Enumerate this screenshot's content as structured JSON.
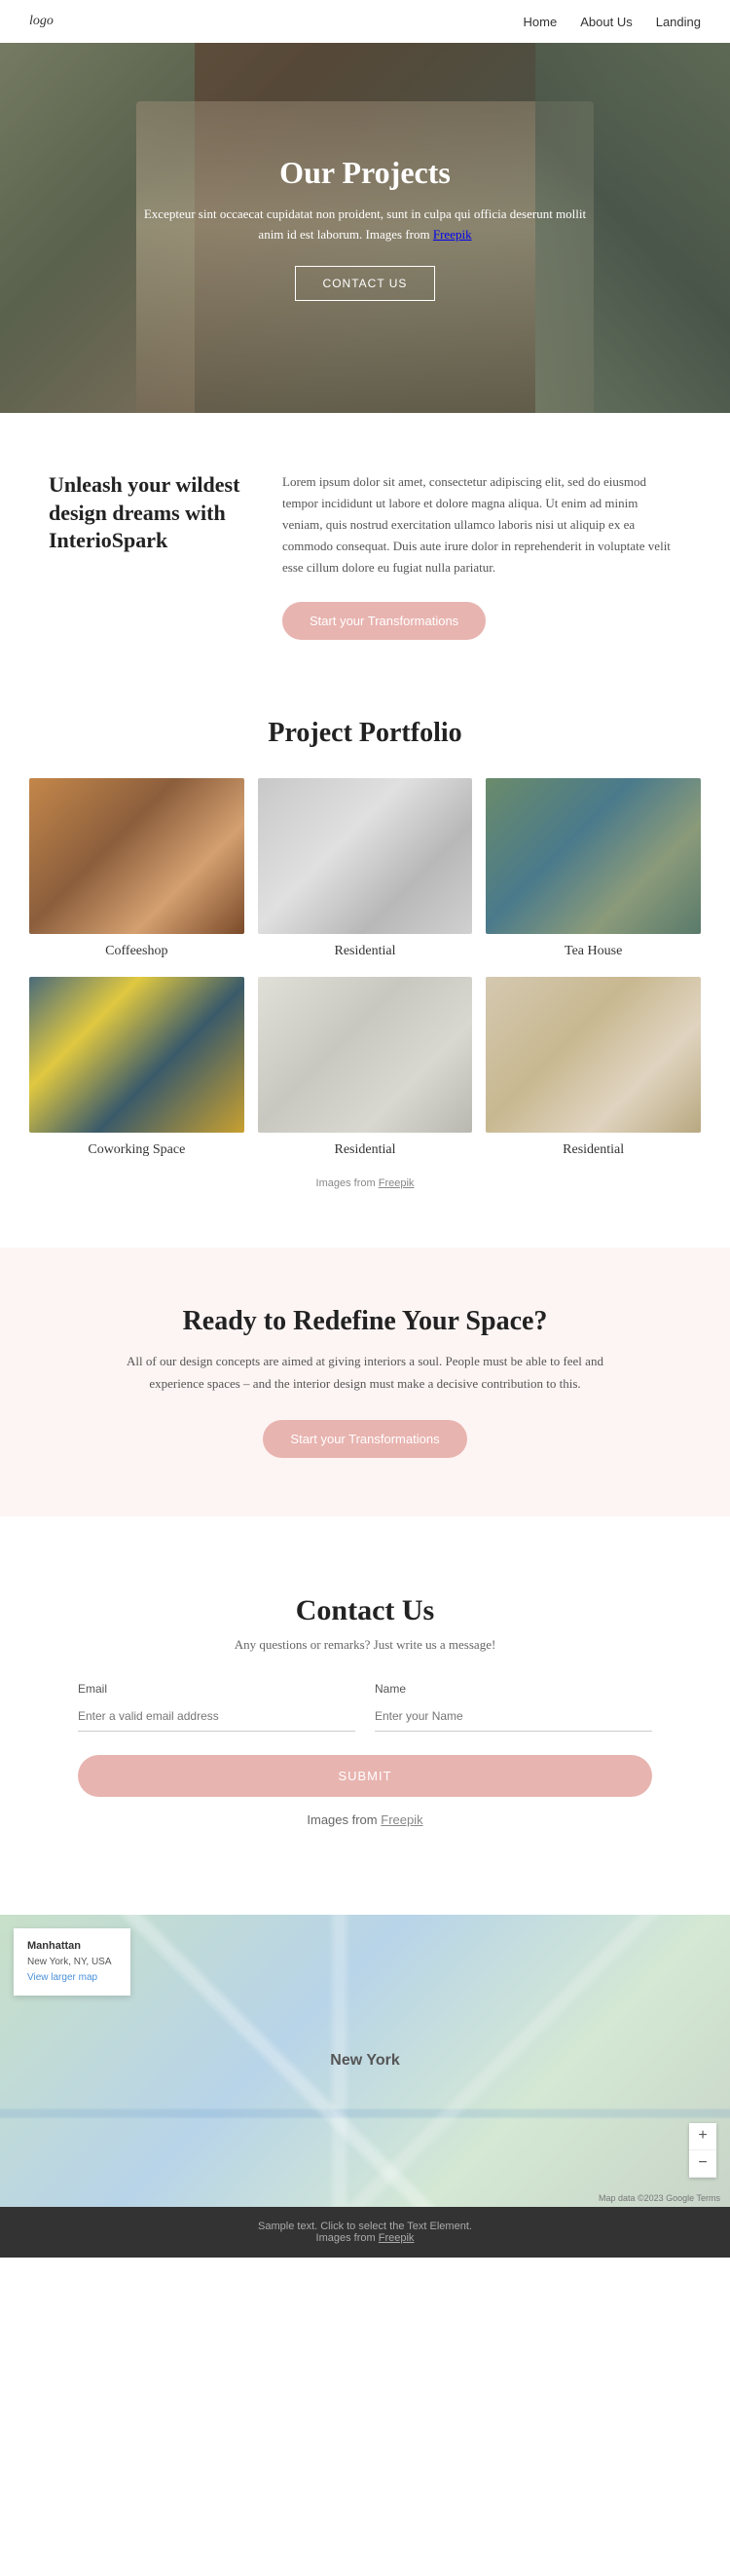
{
  "nav": {
    "logo": "logo",
    "links": [
      {
        "label": "Home",
        "href": "#"
      },
      {
        "label": "About Us",
        "href": "#"
      },
      {
        "label": "Landing",
        "href": "#"
      }
    ]
  },
  "hero": {
    "title": "Our Projects",
    "subtitle": "Excepteur sint occaecat cupidatat non proident, sunt in culpa qui officia deserunt mollit anim id est laborum. Images from",
    "freepik_text": "Freepik",
    "cta_label": "CONTACT US"
  },
  "unleash": {
    "heading": "Unleash your wildest design dreams with InterioSpark",
    "body": "Lorem ipsum dolor sit amet, consectetur adipiscing elit, sed do eiusmod tempor incididunt ut labore et dolore magna aliqua. Ut enim ad minim veniam, quis nostrud exercitation ullamco laboris nisi ut aliquip ex ea commodo consequat. Duis aute irure dolor in reprehenderit in voluptate velit esse cillum dolore eu fugiat nulla pariatur.",
    "cta_label": "Start your Transformations"
  },
  "portfolio": {
    "title": "Project Portfolio",
    "images_note": "Images from",
    "freepik_text": "Freepik",
    "items": [
      {
        "label": "Coffeeshop",
        "img_class": "img-coffeeshop"
      },
      {
        "label": "Residential",
        "img_class": "img-residential1"
      },
      {
        "label": "Tea House",
        "img_class": "img-teahouse"
      },
      {
        "label": "Coworking Space",
        "img_class": "img-coworking"
      },
      {
        "label": "Residential",
        "img_class": "img-residential2"
      },
      {
        "label": "Residential",
        "img_class": "img-residential3"
      }
    ]
  },
  "ready": {
    "title": "Ready to Redefine Your Space?",
    "body": "All of our design concepts are aimed at giving interiors a soul. People must be able to feel and experience spaces – and the interior design must make a decisive contribution to this.",
    "cta_label": "Start your Transformations"
  },
  "contact": {
    "title": "Contact Us",
    "subtitle": "Any questions or remarks? Just write us a message!",
    "email_label": "Email",
    "email_placeholder": "Enter a valid email address",
    "name_label": "Name",
    "name_placeholder": "Enter your Name",
    "submit_label": "SUBMIT",
    "images_note": "Images from",
    "freepik_text": "Freepik"
  },
  "map": {
    "location_name": "Manhattan",
    "location_address": "New York, NY, USA",
    "view_larger": "View larger map",
    "city_label": "New York",
    "attribution": "Map data ©2023 Google  Terms",
    "zoom_in": "+",
    "zoom_out": "−"
  },
  "footer": {
    "sample_text": "Sample text. Click to select the Text Element.",
    "images_note": "Images from",
    "freepik_text": "Freepik"
  }
}
